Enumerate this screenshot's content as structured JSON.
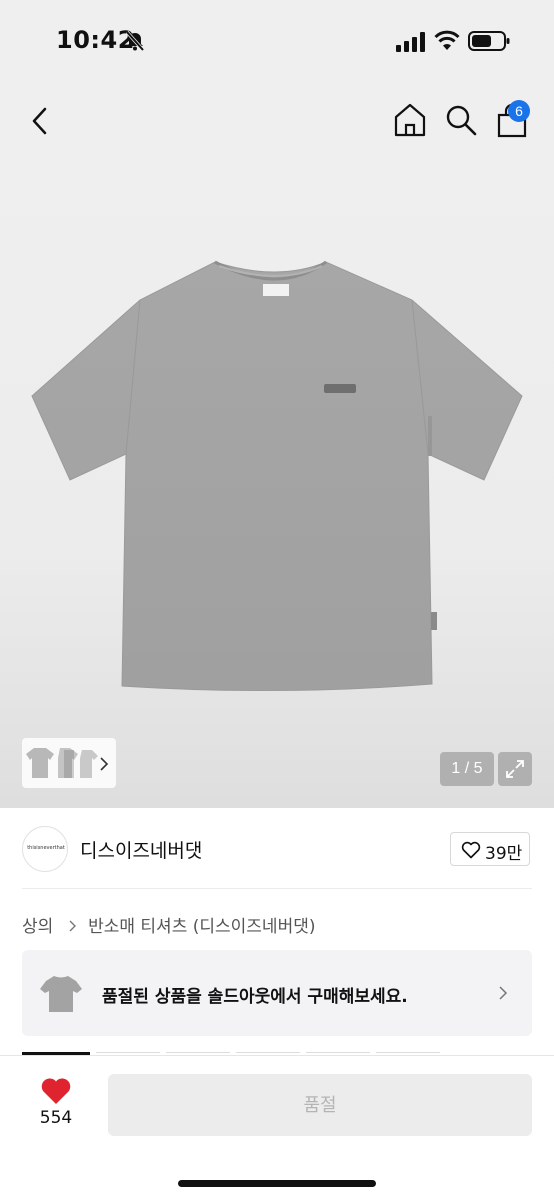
{
  "status_bar": {
    "time": "10:42",
    "icons": [
      "bell-slash-icon",
      "signal-icon",
      "wifi-icon",
      "battery-icon"
    ]
  },
  "header": {
    "icons": [
      "back-icon",
      "home-icon",
      "search-icon",
      "shopping-bag-icon"
    ],
    "cart_count": "6",
    "cart_badge_color": "#1a73e8"
  },
  "gallery": {
    "page_indicator": "1 / 5",
    "icons": [
      "chevron-right-icon",
      "expand-icon"
    ]
  },
  "brand": {
    "logo_text": "thisisneverthat",
    "name": "디스이즈네버댓",
    "likes": "39만"
  },
  "breadcrumb": {
    "category": "상의",
    "subcategory": "반소매 티셔츠 (디스이즈네버댓)"
  },
  "soldout_banner": {
    "text": "품절된 상품을 솔드아웃에서 구매해보세요."
  },
  "bottom_bar": {
    "like_count": "554",
    "heart_color": "#e0242f",
    "button_label": "품절"
  }
}
